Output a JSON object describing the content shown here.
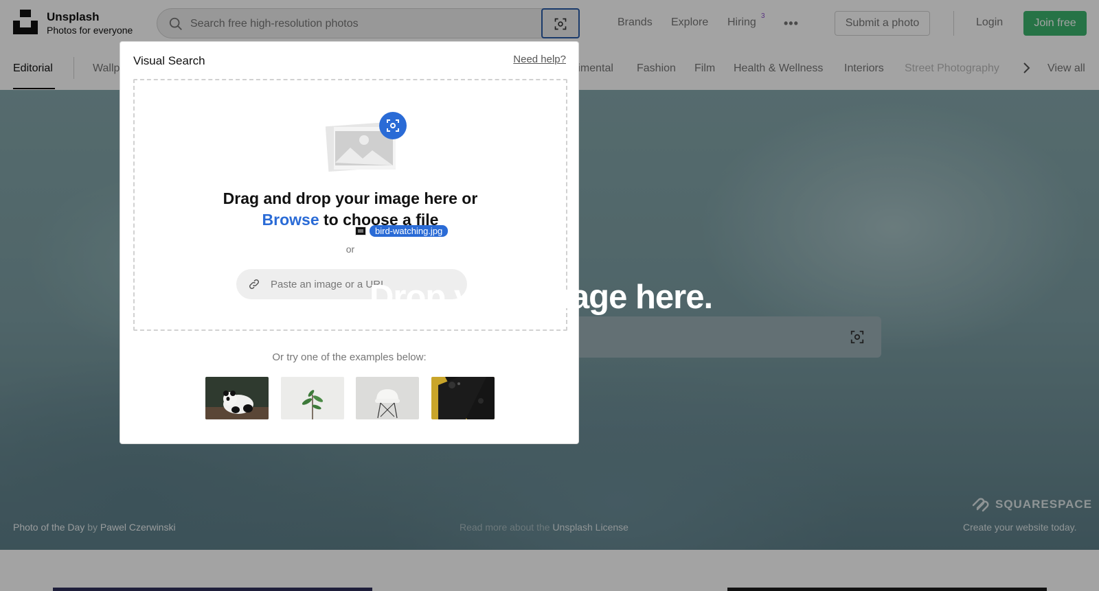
{
  "header": {
    "brand_name": "Unsplash",
    "brand_tagline": "Photos for everyone",
    "search_placeholder": "Search free high-resolution photos",
    "nav": [
      "Brands",
      "Explore",
      "Hiring"
    ],
    "hiring_badge": "3",
    "more": "•••",
    "submit_label": "Submit a photo",
    "login_label": "Login",
    "join_label": "Join free"
  },
  "categories": {
    "items": [
      "Editorial",
      "Wallp",
      "rimental",
      "Fashion",
      "Film",
      "Health & Wellness",
      "Interiors",
      "Street Photography"
    ],
    "view_all": "View all"
  },
  "hero": {
    "potd_prefix": "Photo of the Day",
    "potd_by": "by",
    "potd_author": "Pawel Czerwinski",
    "license_prefix": "Read more about the",
    "license_link": "Unsplash License",
    "sponsor_name": "SQUARESPACE",
    "sponsor_cta": "Create your website today."
  },
  "visual_search": {
    "title": "Visual Search",
    "help": "Need help?",
    "drag_line1": "Drag and drop your image here or",
    "browse": "Browse",
    "drag_line2_rest": "to choose a file",
    "or": "or",
    "url_placeholder": "Paste an image or a URL",
    "examples_label": "Or try one of the examples below:",
    "examples": [
      "panda",
      "plant",
      "chair",
      "phone"
    ]
  },
  "drag": {
    "file_name": "bird-watching.jpg",
    "drop_message": "Drop your image here."
  },
  "colors": {
    "accent": "#2a6bd6",
    "join": "#3cb46e",
    "focus_border": "#2a5ca8"
  }
}
